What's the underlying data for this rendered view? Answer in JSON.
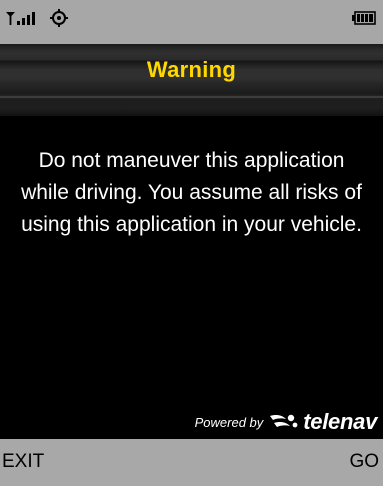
{
  "status_bar": {
    "icons": [
      "signal-icon",
      "settings-icon",
      "battery-icon"
    ]
  },
  "title": "Warning",
  "message": "Do not maneuver this application while driving. You assume all risks of using this application in your vehicle.",
  "branding": {
    "powered_by": "Powered by",
    "brand": "telenav"
  },
  "softkeys": {
    "left_label": "EXIT",
    "right_label": "GO"
  },
  "colors": {
    "title_text": "#ffd800",
    "status_bar_bg": "#a7a7a7",
    "softkey_bar_bg": "#a8a8a8",
    "screen_bg": "#000000"
  }
}
